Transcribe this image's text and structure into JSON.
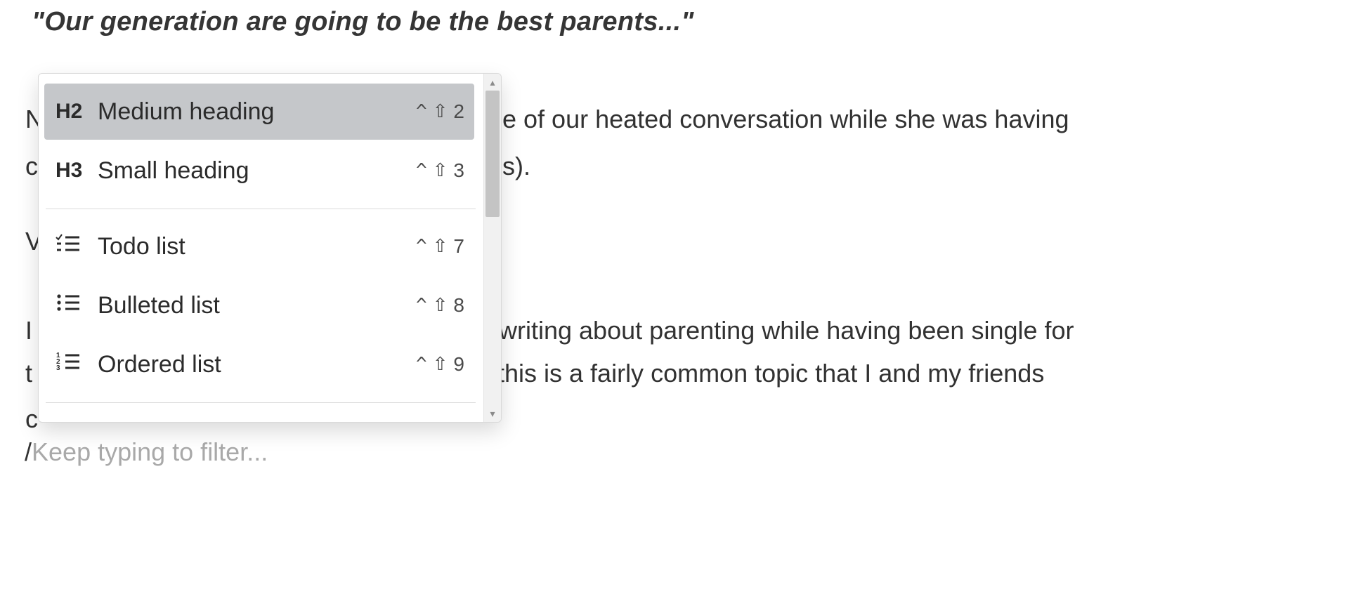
{
  "quote": "\"Our generation are going to be the best parents...\"",
  "bg": {
    "l1a": "N",
    "l1b": "e of our heated conversation while she was having",
    "l2a": "c",
    "l2b": "s).",
    "l3a": "V",
    "l4a": "I",
    "l4b": "Z writing about parenting while having been single for",
    "l5a": "t",
    "l5b": "t, this is a fairly common topic that I and my friends",
    "l6a": "c"
  },
  "slash": {
    "char": "/",
    "placeholder": "Keep typing to filter..."
  },
  "dropdown": {
    "items": [
      {
        "icon_text": "H2",
        "label": "Medium heading",
        "shortcut_num": "2"
      },
      {
        "icon_text": "H3",
        "label": "Small heading",
        "shortcut_num": "3"
      },
      {
        "icon_text": "",
        "label": "Todo list",
        "shortcut_num": "7"
      },
      {
        "icon_text": "",
        "label": "Bulleted list",
        "shortcut_num": "8"
      },
      {
        "icon_text": "",
        "label": "Ordered list",
        "shortcut_num": "9"
      }
    ],
    "shortcut_caret": "^",
    "shortcut_shift": "⇧"
  }
}
